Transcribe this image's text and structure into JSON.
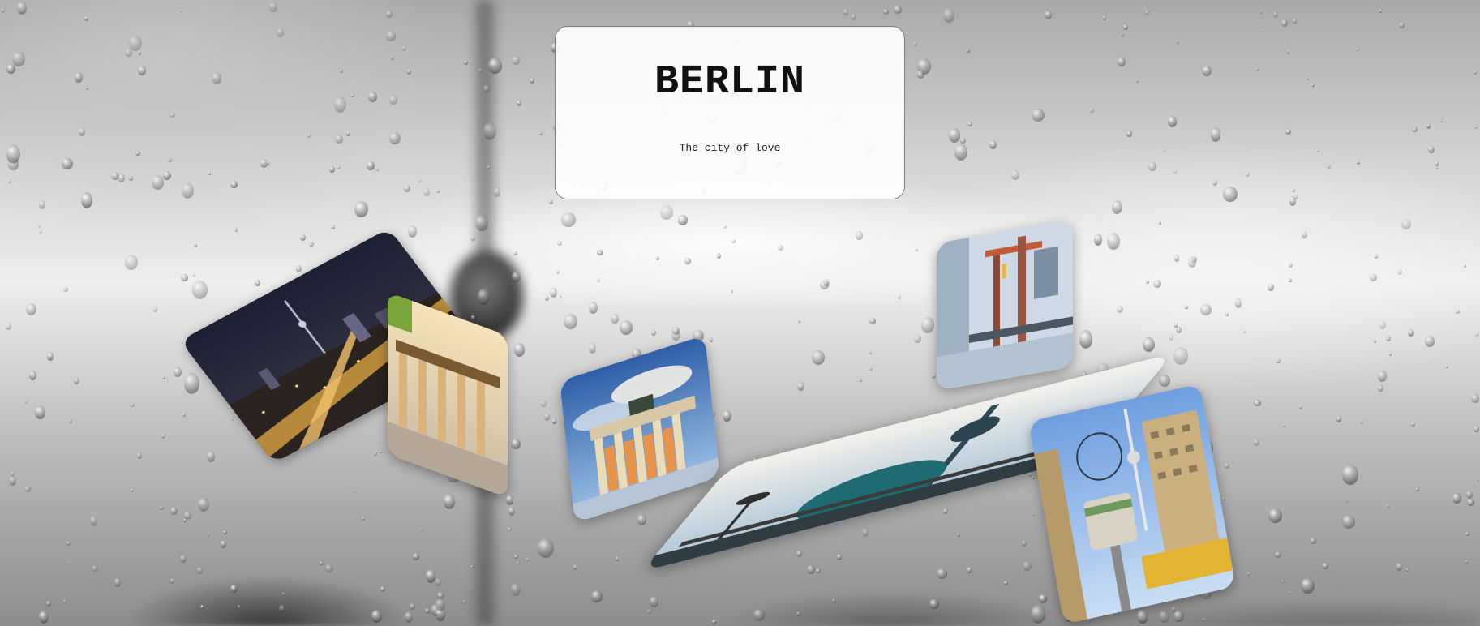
{
  "header": {
    "title": "BERLIN",
    "subtitle": "The city of love"
  },
  "photos": [
    {
      "name": "photo-night-city",
      "icon": "night-skyline-photo"
    },
    {
      "name": "photo-brandenburg-gate-sunset",
      "icon": "brandenburg-gate-photo"
    },
    {
      "name": "photo-brandenburg-gate-blue-sky",
      "icon": "brandenburg-gate-photo"
    },
    {
      "name": "photo-oberbaum-bridge",
      "icon": "river-bridge-photo"
    },
    {
      "name": "photo-tv-tower-cathedral",
      "icon": "tv-tower-photo"
    },
    {
      "name": "photo-world-clock",
      "icon": "world-clock-photo"
    }
  ],
  "colors": {
    "card_bg": "#ffffff",
    "card_border": "#7d7d7d",
    "title_text": "#111111",
    "background_gray": "#bdbdbd"
  }
}
